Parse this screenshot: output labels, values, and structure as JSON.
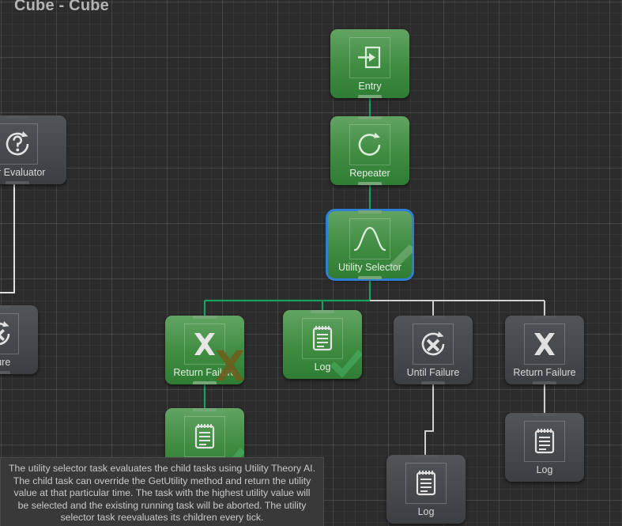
{
  "window": {
    "title": "Cube - Cube"
  },
  "theme": {
    "background": "#2c2c2c",
    "grid_minor": "#343434",
    "grid_major": "#3c3c3c",
    "node_green": "#3f8c41",
    "node_gray": "#45494c",
    "selection_outline": "#2f7fd4",
    "wire_active": "#24a05a",
    "wire_inactive": "#d8d8d8",
    "label_text": "#d8d8d8",
    "title_text": "#b4b4b4",
    "tooltip_bg": "#393939",
    "tooltip_text": "#c9c9c9",
    "watermark_success": "#2f9d4f",
    "watermark_failure": "#6b5f1e"
  },
  "nodes": [
    {
      "id": "entry",
      "label": "Entry",
      "icon": "enter-arrow-icon",
      "state": "running",
      "color": "green"
    },
    {
      "id": "repeater",
      "label": "Repeater",
      "icon": "loop-arrow-icon",
      "state": "running",
      "color": "green"
    },
    {
      "id": "utility-selector",
      "label": "Utility Selector",
      "icon": "bell-curve-icon",
      "state": "running",
      "color": "green",
      "selected": true
    },
    {
      "id": "return-failure-1",
      "label": "Return Failure",
      "icon": "x-mark-icon",
      "state": "failure",
      "color": "green",
      "watermark": "failure-x-watermark"
    },
    {
      "id": "log-1",
      "label": "Log",
      "icon": "notepad-icon",
      "state": "success",
      "color": "green",
      "watermark": "success-check-watermark"
    },
    {
      "id": "until-failure",
      "label": "Until Failure",
      "icon": "circular-x-icon",
      "state": "inactive",
      "color": "gray"
    },
    {
      "id": "return-failure-2",
      "label": "Return Failure",
      "icon": "x-mark-icon",
      "state": "inactive",
      "color": "gray"
    },
    {
      "id": "log-2",
      "label": "Log",
      "icon": "notepad-icon",
      "state": "success",
      "color": "green",
      "watermark": "success-check-watermark"
    },
    {
      "id": "log-3",
      "label": "Log",
      "icon": "notepad-icon",
      "state": "inactive",
      "color": "gray"
    },
    {
      "id": "log-4",
      "label": "Log",
      "icon": "notepad-icon",
      "state": "inactive",
      "color": "gray"
    },
    {
      "id": "offscreen-evaluator",
      "label": "tor Evaluator",
      "icon": "question-loop-icon",
      "state": "inactive",
      "color": "gray"
    },
    {
      "id": "offscreen-until-failure",
      "label": "ailure",
      "icon": "circular-x-icon",
      "state": "inactive",
      "color": "gray"
    }
  ],
  "tooltip": {
    "text": "The utility selector task evaluates the child tasks using Utility Theory AI. The child task can override the GetUtility method and return the utility value at that particular time. The task with the highest utility value will be selected and the existing running task will be aborted. The utility selector task reevaluates its children every tick."
  }
}
